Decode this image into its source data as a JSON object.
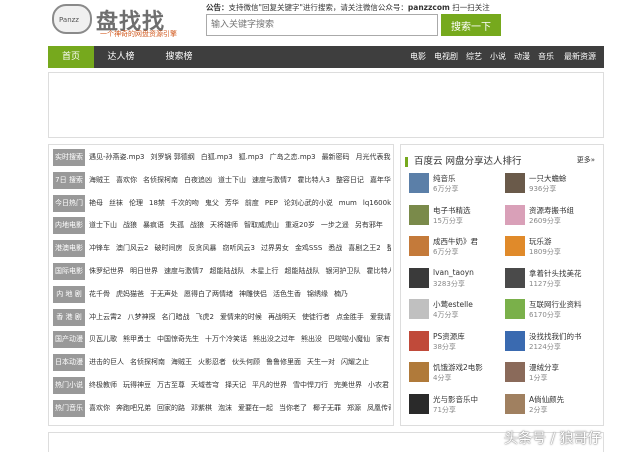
{
  "header": {
    "logo_label": "Panzz",
    "logo_text": "盘找找",
    "slogan": "一个神奇的网盘资源引擎",
    "notice_prefix": "公告：",
    "notice_text": "支持微信\"回复关键字\"进行搜索，请关注微信公众号：",
    "notice_account": "panzzcom",
    "notice_suffix": " 扫一扫关注",
    "search_placeholder": "输入关键字搜索",
    "search_button": "搜索一下"
  },
  "nav": {
    "left": [
      "首页",
      "达人榜",
      "搜索榜"
    ],
    "right": [
      "电影",
      "电视剧",
      "综艺",
      "小说",
      "动漫",
      "音乐",
      "最新资源"
    ],
    "accent": "#76a91d",
    "bg": "#3e3e3e"
  },
  "rows": [
    {
      "tag": "实时搜索",
      "items": [
        "遇见-孙燕姿.mp3",
        "刘罗锅 郭德纲",
        "白狐.mp3",
        "狐.mp3",
        "广岛之恋.mp3",
        "最新密码",
        "月光代表我"
      ]
    },
    {
      "tag": "7日 搜索",
      "items": [
        "海贼王",
        "喜欢你",
        "名侦探柯南",
        "白夜追凶",
        "道士下山",
        "速度与激情7",
        "霍比特人3",
        "整容日记",
        "嘉年华"
      ]
    },
    {
      "tag": "今日热门",
      "items": [
        "艳母",
        "丝袜",
        "伦理",
        "18禁",
        "千次的吻",
        "鬼父",
        "芳华",
        "前度",
        "PEP",
        "论刘心武的小说",
        "mum",
        "lq1600k"
      ]
    },
    {
      "tag": "内地电影",
      "items": [
        "道士下山",
        "战狼",
        "暴疯语",
        "失孤",
        "战狼",
        "天将雄师",
        "智取威虎山",
        "重返20岁",
        "一步之遥",
        "另有邪年"
      ]
    },
    {
      "tag": "港澳电影",
      "items": [
        "冲锋车",
        "澳门风云2",
        "破时间房",
        "反贪风暴",
        "窃听风云3",
        "过界男女",
        "金鸡SSS",
        "悉战",
        "喜剧之王2",
        "整容"
      ]
    },
    {
      "tag": "国际电影",
      "items": [
        "侏罗纪世界",
        "明日世界",
        "速度与激情7",
        "超能陆战队",
        "木星上行",
        "超能陆战队",
        "银河护卫队",
        "霍比特人3"
      ]
    },
    {
      "tag": "内 地 剧",
      "items": [
        "花千骨",
        "虎妈猫爸",
        "于无声处",
        "愿得白了两情绪",
        "神雕侠侣",
        "活色生香",
        "锦绣缘",
        "楠乃"
      ]
    },
    {
      "tag": "香 港 剧",
      "items": [
        "冲上云霄2",
        "八梦神探",
        "名门暗战",
        "飞虎2",
        "爱情来的时候",
        "再战明天",
        "使徒行者",
        "点金胜手",
        "爱我请留"
      ]
    },
    {
      "tag": "国产动漫",
      "items": [
        "贝瓦儿歌",
        "熊甲勇士",
        "中国惊奇先生",
        "十万个冷笑话",
        "熊出没之过年",
        "熊出没",
        "巴啦啦小魔仙",
        "家有"
      ]
    },
    {
      "tag": "日本动漫",
      "items": [
        "进击的巨人",
        "名侦探柯南",
        "海贼王",
        "火影忍者",
        "伙头何顾",
        "鲁鲁修里面",
        "天生一对",
        "闪耀之止"
      ]
    },
    {
      "tag": "热门小说",
      "items": [
        "终极教师",
        "玩得神豆",
        "万古至尊",
        "天域苍穹",
        "择天记",
        "平凡的世界",
        "雪中悍刀行",
        "完美世界",
        "小农君"
      ]
    },
    {
      "tag": "热门音乐",
      "items": [
        "喜欢你",
        "奔跑吧兄弟",
        "回家的路",
        "邓紫棋",
        "泡沫",
        "爱要在一起",
        "当你老了",
        "椰子无罪",
        "郑源",
        "凤凰传奇"
      ]
    }
  ],
  "ranking": {
    "title": "百度云 网盘分享达人排行",
    "more": "更多»",
    "users": [
      {
        "name": "纯音乐",
        "shares": "6万分享",
        "color": "#5b7fa8"
      },
      {
        "name": "一只大蟾蜍",
        "shares": "936分享",
        "color": "#6a5a4a"
      },
      {
        "name": "电子书精选",
        "shares": "15万分享",
        "color": "#7a8a4a"
      },
      {
        "name": "资源寿搬书组",
        "shares": "2609分享",
        "color": "#d9a0b8"
      },
      {
        "name": "成西牛奶》君",
        "shares": "6万分享",
        "color": "#c47a3a"
      },
      {
        "name": "玩乐游",
        "shares": "1809分享",
        "color": "#e08a2a"
      },
      {
        "name": "lvan_taoyn",
        "shares": "3283分享",
        "color": "#3a3a3a"
      },
      {
        "name": "拿着针头找美花",
        "shares": "1127分享",
        "color": "#4a4a4a"
      },
      {
        "name": "小莺estelle",
        "shares": "4万分享",
        "color": "#c0c0c0"
      },
      {
        "name": "互联网行业资料",
        "shares": "6170分享",
        "color": "#7ab04a"
      },
      {
        "name": "PS资源库",
        "shares": "38分享",
        "color": "#c04a3a"
      },
      {
        "name": "没找找我们的书",
        "shares": "2124分享",
        "color": "#3a6ab0"
      },
      {
        "name": "饥饿游戏2电影",
        "shares": "4分享",
        "color": "#b07a3a"
      },
      {
        "name": "漫绒分享",
        "shares": "1分享",
        "color": "#8a6a5a"
      },
      {
        "name": "光与影音乐中",
        "shares": "71分享",
        "color": "#2a2a2a"
      },
      {
        "name": "A倘仙颜先",
        "shares": "2分享",
        "color": "#a08060"
      }
    ]
  },
  "watermark": "头条号 / 狼哥仔"
}
